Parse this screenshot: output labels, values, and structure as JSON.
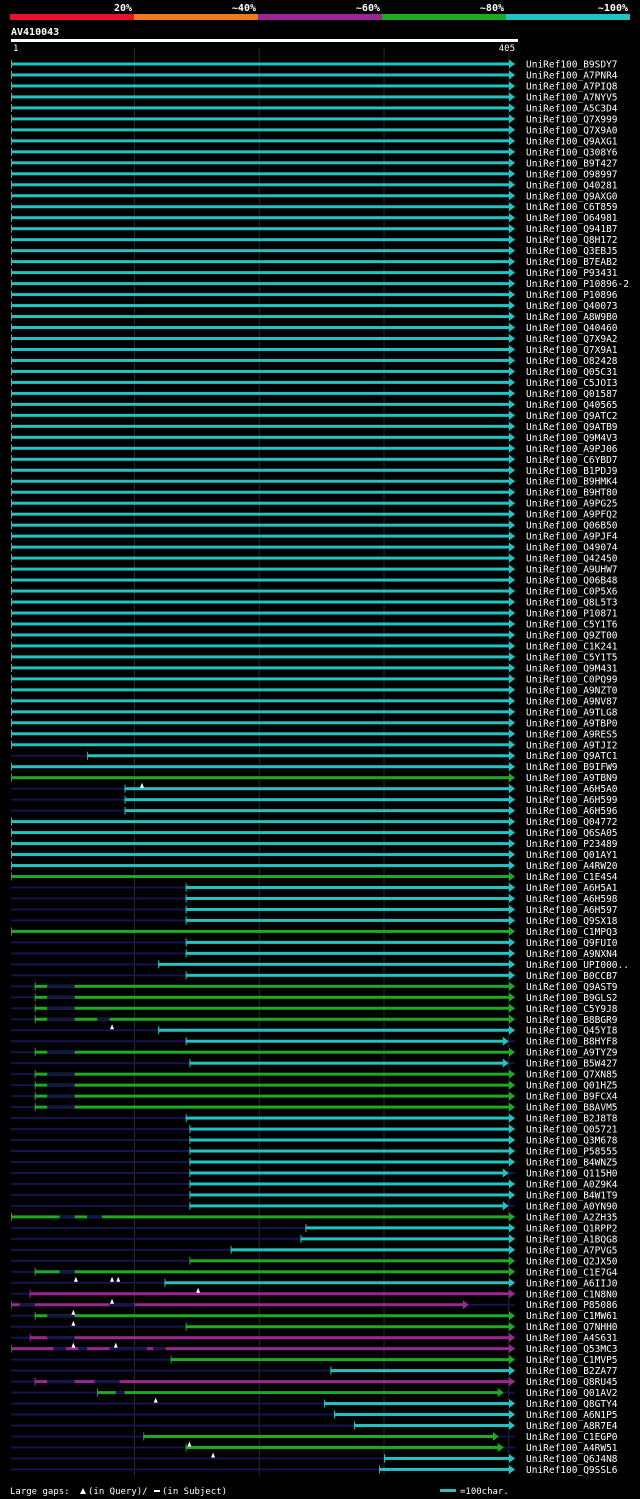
{
  "legend": {
    "labels": [
      "20%",
      "~40%",
      "~60%",
      "~80%",
      "~100%"
    ],
    "colors": [
      "#e8102a",
      "#ee7a1e",
      "#9b2795",
      "#1eaa22",
      "#22c3c3"
    ]
  },
  "query": {
    "name": "AV410043",
    "start": "1",
    "end": "405",
    "length": 405
  },
  "colors": {
    "c": "#22c3c3",
    "g": "#1eaa22",
    "m": "#9b2795",
    "gap": "#141450",
    "bg": "#000000",
    "grid": "#2a2a2a",
    "text": "#ffffff"
  },
  "footer": {
    "gaps_prefix": "Large gaps:",
    "gaps_query": "(in Query)/",
    "gaps_subject": "(in Subject)",
    "scale": "=100char."
  },
  "chart_data": {
    "type": "alignment",
    "x_range": [
      1,
      405
    ],
    "grid_step": 100,
    "rows": [
      {
        "id": "UniRef100_B9SDY7",
        "s": 1,
        "e": 405,
        "c": "c",
        "d": []
      },
      {
        "id": "UniRef100_A7PNR4",
        "s": 1,
        "e": 405,
        "c": "c",
        "d": []
      },
      {
        "id": "UniRef100_A7PIQ8",
        "s": 1,
        "e": 405,
        "c": "c",
        "d": []
      },
      {
        "id": "UniRef100_A7NYV5",
        "s": 1,
        "e": 405,
        "c": "c",
        "d": []
      },
      {
        "id": "UniRef100_A5C3D4",
        "s": 1,
        "e": 405,
        "c": "c",
        "d": []
      },
      {
        "id": "UniRef100_Q7X999",
        "s": 1,
        "e": 405,
        "c": "c",
        "d": []
      },
      {
        "id": "UniRef100_Q7X9A0",
        "s": 1,
        "e": 405,
        "c": "c",
        "d": []
      },
      {
        "id": "UniRef100_Q9AXG1",
        "s": 1,
        "e": 405,
        "c": "c",
        "d": []
      },
      {
        "id": "UniRef100_Q308Y6",
        "s": 1,
        "e": 405,
        "c": "c",
        "d": []
      },
      {
        "id": "UniRef100_B9T427",
        "s": 1,
        "e": 405,
        "c": "c",
        "d": []
      },
      {
        "id": "UniRef100_O98997",
        "s": 1,
        "e": 405,
        "c": "c",
        "d": []
      },
      {
        "id": "UniRef100_Q40281",
        "s": 1,
        "e": 405,
        "c": "c",
        "d": []
      },
      {
        "id": "UniRef100_Q9AXG0",
        "s": 1,
        "e": 405,
        "c": "c",
        "d": []
      },
      {
        "id": "UniRef100_C6T859",
        "s": 1,
        "e": 405,
        "c": "c",
        "d": []
      },
      {
        "id": "UniRef100_O64981",
        "s": 1,
        "e": 405,
        "c": "c",
        "d": []
      },
      {
        "id": "UniRef100_Q941B7",
        "s": 1,
        "e": 405,
        "c": "c",
        "d": []
      },
      {
        "id": "UniRef100_Q8H172",
        "s": 1,
        "e": 405,
        "c": "c",
        "d": []
      },
      {
        "id": "UniRef100_Q3EBJ5",
        "s": 1,
        "e": 405,
        "c": "c",
        "d": []
      },
      {
        "id": "UniRef100_B7EAB2",
        "s": 1,
        "e": 405,
        "c": "c",
        "d": []
      },
      {
        "id": "UniRef100_P93431",
        "s": 1,
        "e": 405,
        "c": "c",
        "d": []
      },
      {
        "id": "UniRef100_P10896-2",
        "s": 1,
        "e": 405,
        "c": "c",
        "d": []
      },
      {
        "id": "UniRef100_P10896",
        "s": 1,
        "e": 405,
        "c": "c",
        "d": []
      },
      {
        "id": "UniRef100_Q40073",
        "s": 1,
        "e": 405,
        "c": "c",
        "d": []
      },
      {
        "id": "UniRef100_A8W9B0",
        "s": 1,
        "e": 405,
        "c": "c",
        "d": []
      },
      {
        "id": "UniRef100_Q40460",
        "s": 1,
        "e": 405,
        "c": "c",
        "d": []
      },
      {
        "id": "UniRef100_Q7X9A2",
        "s": 1,
        "e": 405,
        "c": "c",
        "d": []
      },
      {
        "id": "UniRef100_Q7X9A1",
        "s": 1,
        "e": 405,
        "c": "c",
        "d": []
      },
      {
        "id": "UniRef100_O82428",
        "s": 1,
        "e": 405,
        "c": "c",
        "d": []
      },
      {
        "id": "UniRef100_Q05C31",
        "s": 1,
        "e": 405,
        "c": "c",
        "d": []
      },
      {
        "id": "UniRef100_C5JOI3",
        "s": 1,
        "e": 405,
        "c": "c",
        "d": []
      },
      {
        "id": "UniRef100_Q01587",
        "s": 1,
        "e": 405,
        "c": "c",
        "d": []
      },
      {
        "id": "UniRef100_Q40565",
        "s": 1,
        "e": 405,
        "c": "c",
        "d": []
      },
      {
        "id": "UniRef100_Q9ATC2",
        "s": 1,
        "e": 405,
        "c": "c",
        "d": []
      },
      {
        "id": "UniRef100_Q9ATB9",
        "s": 1,
        "e": 405,
        "c": "c",
        "d": []
      },
      {
        "id": "UniRef100_Q9M4V3",
        "s": 1,
        "e": 405,
        "c": "c",
        "d": []
      },
      {
        "id": "UniRef100_A9PJ06",
        "s": 1,
        "e": 405,
        "c": "c",
        "d": []
      },
      {
        "id": "UniRef100_C6YBD7",
        "s": 1,
        "e": 405,
        "c": "c",
        "d": []
      },
      {
        "id": "UniRef100_B1PDJ9",
        "s": 1,
        "e": 405,
        "c": "c",
        "d": []
      },
      {
        "id": "UniRef100_B9HMK4",
        "s": 1,
        "e": 405,
        "c": "c",
        "d": []
      },
      {
        "id": "UniRef100_B9HT80",
        "s": 1,
        "e": 405,
        "c": "c",
        "d": []
      },
      {
        "id": "UniRef100_A9PG25",
        "s": 1,
        "e": 405,
        "c": "c",
        "d": []
      },
      {
        "id": "UniRef100_A9PFQ2",
        "s": 1,
        "e": 405,
        "c": "c",
        "d": []
      },
      {
        "id": "UniRef100_Q06B50",
        "s": 1,
        "e": 405,
        "c": "c",
        "d": []
      },
      {
        "id": "UniRef100_A9PJF4",
        "s": 1,
        "e": 405,
        "c": "c",
        "d": []
      },
      {
        "id": "UniRef100_O49074",
        "s": 1,
        "e": 405,
        "c": "c",
        "d": []
      },
      {
        "id": "UniRef100_Q42450",
        "s": 1,
        "e": 405,
        "c": "c",
        "d": []
      },
      {
        "id": "UniRef100_A9UHW7",
        "s": 1,
        "e": 405,
        "c": "c",
        "d": []
      },
      {
        "id": "UniRef100_Q06B48",
        "s": 1,
        "e": 405,
        "c": "c",
        "d": []
      },
      {
        "id": "UniRef100_C0P5X6",
        "s": 1,
        "e": 405,
        "c": "c",
        "d": []
      },
      {
        "id": "UniRef100_Q8L5T3",
        "s": 1,
        "e": 405,
        "c": "c",
        "d": []
      },
      {
        "id": "UniRef100_P10871",
        "s": 1,
        "e": 405,
        "c": "c",
        "d": []
      },
      {
        "id": "UniRef100_C5Y1T6",
        "s": 1,
        "e": 405,
        "c": "c",
        "d": []
      },
      {
        "id": "UniRef100_Q9ZT00",
        "s": 1,
        "e": 405,
        "c": "c",
        "d": []
      },
      {
        "id": "UniRef100_C1K241",
        "s": 1,
        "e": 405,
        "c": "c",
        "d": []
      },
      {
        "id": "UniRef100_C5Y1T5",
        "s": 1,
        "e": 405,
        "c": "c",
        "d": []
      },
      {
        "id": "UniRef100_Q9M431",
        "s": 1,
        "e": 405,
        "c": "c",
        "d": []
      },
      {
        "id": "UniRef100_C0PQ99",
        "s": 1,
        "e": 405,
        "c": "c",
        "d": []
      },
      {
        "id": "UniRef100_A9NZT0",
        "s": 1,
        "e": 405,
        "c": "c",
        "d": []
      },
      {
        "id": "UniRef100_A9NV87",
        "s": 1,
        "e": 405,
        "c": "c",
        "d": []
      },
      {
        "id": "UniRef100_A9TLG8",
        "s": 1,
        "e": 405,
        "c": "c",
        "d": []
      },
      {
        "id": "UniRef100_A9TBP0",
        "s": 1,
        "e": 405,
        "c": "c",
        "d": []
      },
      {
        "id": "UniRef100_A9RES5",
        "s": 1,
        "e": 405,
        "c": "c",
        "d": []
      },
      {
        "id": "UniRef100_A9TJI2",
        "s": 1,
        "e": 405,
        "c": "c",
        "d": []
      },
      {
        "id": "UniRef100_Q9ATC1",
        "s": 62,
        "e": 405,
        "c": "c",
        "d": []
      },
      {
        "id": "UniRef100_B9IFW9",
        "s": 1,
        "e": 405,
        "c": "c",
        "d": []
      },
      {
        "id": "UniRef100_A9TBN9",
        "s": 1,
        "e": 405,
        "c": "g",
        "d": []
      },
      {
        "id": "UniRef100_A6H5A0",
        "s": 92,
        "e": 405,
        "c": "c",
        "d": []
      },
      {
        "id": "UniRef100_A6H599",
        "s": 92,
        "e": 405,
        "c": "c",
        "d": []
      },
      {
        "id": "UniRef100_A6H596",
        "s": 92,
        "e": 405,
        "c": "c",
        "d": []
      },
      {
        "id": "UniRef100_Q04772",
        "s": 1,
        "e": 405,
        "c": "c",
        "d": []
      },
      {
        "id": "UniRef100_Q6SA05",
        "s": 1,
        "e": 405,
        "c": "c",
        "d": []
      },
      {
        "id": "UniRef100_P23489",
        "s": 1,
        "e": 405,
        "c": "c",
        "d": []
      },
      {
        "id": "UniRef100_Q01AY1",
        "s": 1,
        "e": 405,
        "c": "c",
        "d": []
      },
      {
        "id": "UniRef100_A4RW20",
        "s": 1,
        "e": 405,
        "c": "c",
        "d": []
      },
      {
        "id": "UniRef100_C1E4S4",
        "s": 1,
        "e": 405,
        "c": "g",
        "d": []
      },
      {
        "id": "UniRef100_A6H5A1",
        "s": 141,
        "e": 405,
        "c": "c",
        "d": []
      },
      {
        "id": "UniRef100_A6H598",
        "s": 141,
        "e": 405,
        "c": "c",
        "d": []
      },
      {
        "id": "UniRef100_A6H597",
        "s": 141,
        "e": 405,
        "c": "c",
        "d": []
      },
      {
        "id": "UniRef100_Q9SX18",
        "s": 141,
        "e": 405,
        "c": "c",
        "d": []
      },
      {
        "id": "UniRef100_C1MPQ3",
        "s": 1,
        "e": 405,
        "c": "g",
        "d": []
      },
      {
        "id": "UniRef100_Q9FUI0",
        "s": 141,
        "e": 405,
        "c": "c",
        "d": []
      },
      {
        "id": "UniRef100_A9NXN4",
        "s": 141,
        "e": 405,
        "c": "c",
        "d": []
      },
      {
        "id": "UniRef100_UPI000..",
        "s": 119,
        "e": 405,
        "c": "c",
        "d": []
      },
      {
        "id": "UniRef100_B0CCB7",
        "s": 141,
        "e": 405,
        "c": "c",
        "d": []
      },
      {
        "id": "UniRef100_Q9AST9",
        "s": 20,
        "e": 405,
        "c": "g",
        "d": [
          [
            30,
            52
          ]
        ]
      },
      {
        "id": "UniRef100_B9GLS2",
        "s": 20,
        "e": 405,
        "c": "g",
        "d": [
          [
            30,
            52
          ]
        ]
      },
      {
        "id": "UniRef100_C5Y9J8",
        "s": 20,
        "e": 405,
        "c": "g",
        "d": [
          [
            30,
            52
          ]
        ]
      },
      {
        "id": "UniRef100_B8BGR9",
        "s": 20,
        "e": 405,
        "c": "g",
        "d": [
          [
            30,
            52
          ],
          [
            70,
            80
          ]
        ]
      },
      {
        "id": "UniRef100_Q45YI8",
        "s": 119,
        "e": 405,
        "c": "c",
        "d": []
      },
      {
        "id": "UniRef100_B8HYF8",
        "s": 141,
        "e": 400,
        "c": "c",
        "d": []
      },
      {
        "id": "UniRef100_A9TYZ9",
        "s": 20,
        "e": 405,
        "c": "g",
        "d": [
          [
            30,
            52
          ]
        ]
      },
      {
        "id": "UniRef100_B5W427",
        "s": 144,
        "e": 400,
        "c": "c",
        "d": []
      },
      {
        "id": "UniRef100_Q7XN85",
        "s": 20,
        "e": 405,
        "c": "g",
        "d": [
          [
            30,
            52
          ]
        ]
      },
      {
        "id": "UniRef100_Q01HZ5",
        "s": 20,
        "e": 405,
        "c": "g",
        "d": [
          [
            30,
            52
          ]
        ]
      },
      {
        "id": "UniRef100_B9FCX4",
        "s": 20,
        "e": 405,
        "c": "g",
        "d": [
          [
            30,
            52
          ]
        ]
      },
      {
        "id": "UniRef100_B8AVM5",
        "s": 20,
        "e": 405,
        "c": "g",
        "d": [
          [
            30,
            52
          ]
        ]
      },
      {
        "id": "UniRef100_B2J8T8",
        "s": 141,
        "e": 405,
        "c": "c",
        "d": []
      },
      {
        "id": "UniRef100_Q05721",
        "s": 144,
        "e": 405,
        "c": "c",
        "d": []
      },
      {
        "id": "UniRef100_Q3M678",
        "s": 144,
        "e": 405,
        "c": "c",
        "d": []
      },
      {
        "id": "UniRef100_P58555",
        "s": 144,
        "e": 405,
        "c": "c",
        "d": []
      },
      {
        "id": "UniRef100_B4WNZ5",
        "s": 144,
        "e": 405,
        "c": "c",
        "d": []
      },
      {
        "id": "UniRef100_Q115H0",
        "s": 144,
        "e": 400,
        "c": "c",
        "d": []
      },
      {
        "id": "UniRef100_A0Z9K4",
        "s": 144,
        "e": 405,
        "c": "c",
        "d": []
      },
      {
        "id": "UniRef100_B4W1T9",
        "s": 144,
        "e": 405,
        "c": "c",
        "d": []
      },
      {
        "id": "UniRef100_A0YN90",
        "s": 144,
        "e": 400,
        "c": "c",
        "d": []
      },
      {
        "id": "UniRef100_A2ZH35",
        "s": 1,
        "e": 405,
        "c": "g",
        "d": [
          [
            40,
            52
          ],
          [
            62,
            74
          ]
        ]
      },
      {
        "id": "UniRef100_Q1RPP2",
        "s": 237,
        "e": 405,
        "c": "c",
        "d": []
      },
      {
        "id": "UniRef100_A1BQG8",
        "s": 233,
        "e": 405,
        "c": "c",
        "d": []
      },
      {
        "id": "UniRef100_A7PVG5",
        "s": 177,
        "e": 405,
        "c": "c",
        "d": []
      },
      {
        "id": "UniRef100_Q2JX50",
        "s": 144,
        "e": 405,
        "c": "g",
        "d": []
      },
      {
        "id": "UniRef100_C1E7G4",
        "s": 20,
        "e": 405,
        "c": "g",
        "d": [
          [
            40,
            52
          ]
        ]
      },
      {
        "id": "UniRef100_A6IIJ0",
        "s": 124,
        "e": 405,
        "c": "c",
        "d": []
      },
      {
        "id": "UniRef100_C1N8N0",
        "s": 16,
        "e": 405,
        "c": "m",
        "d": []
      },
      {
        "id": "UniRef100_P85086",
        "s": 1,
        "e": 368,
        "c": "m",
        "d": [
          [
            8,
            20
          ],
          [
            80,
            100
          ]
        ]
      },
      {
        "id": "UniRef100_C1MW61",
        "s": 20,
        "e": 405,
        "c": "g",
        "d": [
          [
            30,
            52
          ]
        ]
      },
      {
        "id": "UniRef100_Q7NHH0",
        "s": 141,
        "e": 405,
        "c": "g",
        "d": []
      },
      {
        "id": "UniRef100_A4S631",
        "s": 16,
        "e": 405,
        "c": "m",
        "d": [
          [
            30,
            52
          ]
        ]
      },
      {
        "id": "UniRef100_Q53MC3",
        "s": 1,
        "e": 405,
        "c": "m",
        "d": [
          [
            35,
            45
          ],
          [
            55,
            62
          ],
          [
            80,
            110
          ],
          [
            115,
            125
          ]
        ]
      },
      {
        "id": "UniRef100_C1MVP5",
        "s": 129,
        "e": 405,
        "c": "g",
        "d": []
      },
      {
        "id": "UniRef100_B2ZA77",
        "s": 257,
        "e": 405,
        "c": "c",
        "d": []
      },
      {
        "id": "UniRef100_Q8RU45",
        "s": 20,
        "e": 405,
        "c": "m",
        "d": [
          [
            30,
            52
          ],
          [
            68,
            88
          ]
        ]
      },
      {
        "id": "UniRef100_Q01AV2",
        "s": 70,
        "e": 396,
        "c": "g",
        "d": [
          [
            85,
            92
          ]
        ]
      },
      {
        "id": "UniRef100_Q8GTY4",
        "s": 252,
        "e": 405,
        "c": "c",
        "d": []
      },
      {
        "id": "UniRef100_A6N1P5",
        "s": 260,
        "e": 405,
        "c": "c",
        "d": []
      },
      {
        "id": "UniRef100_A8R7E4",
        "s": 276,
        "e": 405,
        "c": "c",
        "d": []
      },
      {
        "id": "UniRef100_C1EGP0",
        "s": 107,
        "e": 392,
        "c": "g",
        "d": []
      },
      {
        "id": "UniRef100_A4RW51",
        "s": 141,
        "e": 396,
        "c": "g",
        "d": []
      },
      {
        "id": "UniRef100_Q6J4N8",
        "s": 300,
        "e": 405,
        "c": "c",
        "d": []
      },
      {
        "id": "UniRef100_Q9SSL6",
        "s": 296,
        "e": 405,
        "c": "c",
        "d": []
      }
    ],
    "gap_marks": [
      {
        "row": "UniRef100_A9TBN9",
        "pos": 106
      },
      {
        "row": "UniRef100_B8BGR9",
        "pos": 82
      },
      {
        "row": "UniRef100_C1E7G4",
        "pos": 53
      },
      {
        "row": "UniRef100_C1E7G4",
        "pos": 82
      },
      {
        "row": "UniRef100_C1E7G4",
        "pos": 87
      },
      {
        "row": "UniRef100_A6IIJ0",
        "pos": 151
      },
      {
        "row": "UniRef100_C1N8N0",
        "pos": 82
      },
      {
        "row": "UniRef100_P85086",
        "pos": 51
      },
      {
        "row": "UniRef100_C1MW61",
        "pos": 51
      },
      {
        "row": "UniRef100_A4S631",
        "pos": 51
      },
      {
        "row": "UniRef100_A4S631",
        "pos": 85
      },
      {
        "row": "UniRef100_Q01AV2",
        "pos": 117
      },
      {
        "row": "UniRef100_C1EGP0",
        "pos": 144
      },
      {
        "row": "UniRef100_A4RW51",
        "pos": 163
      }
    ]
  }
}
